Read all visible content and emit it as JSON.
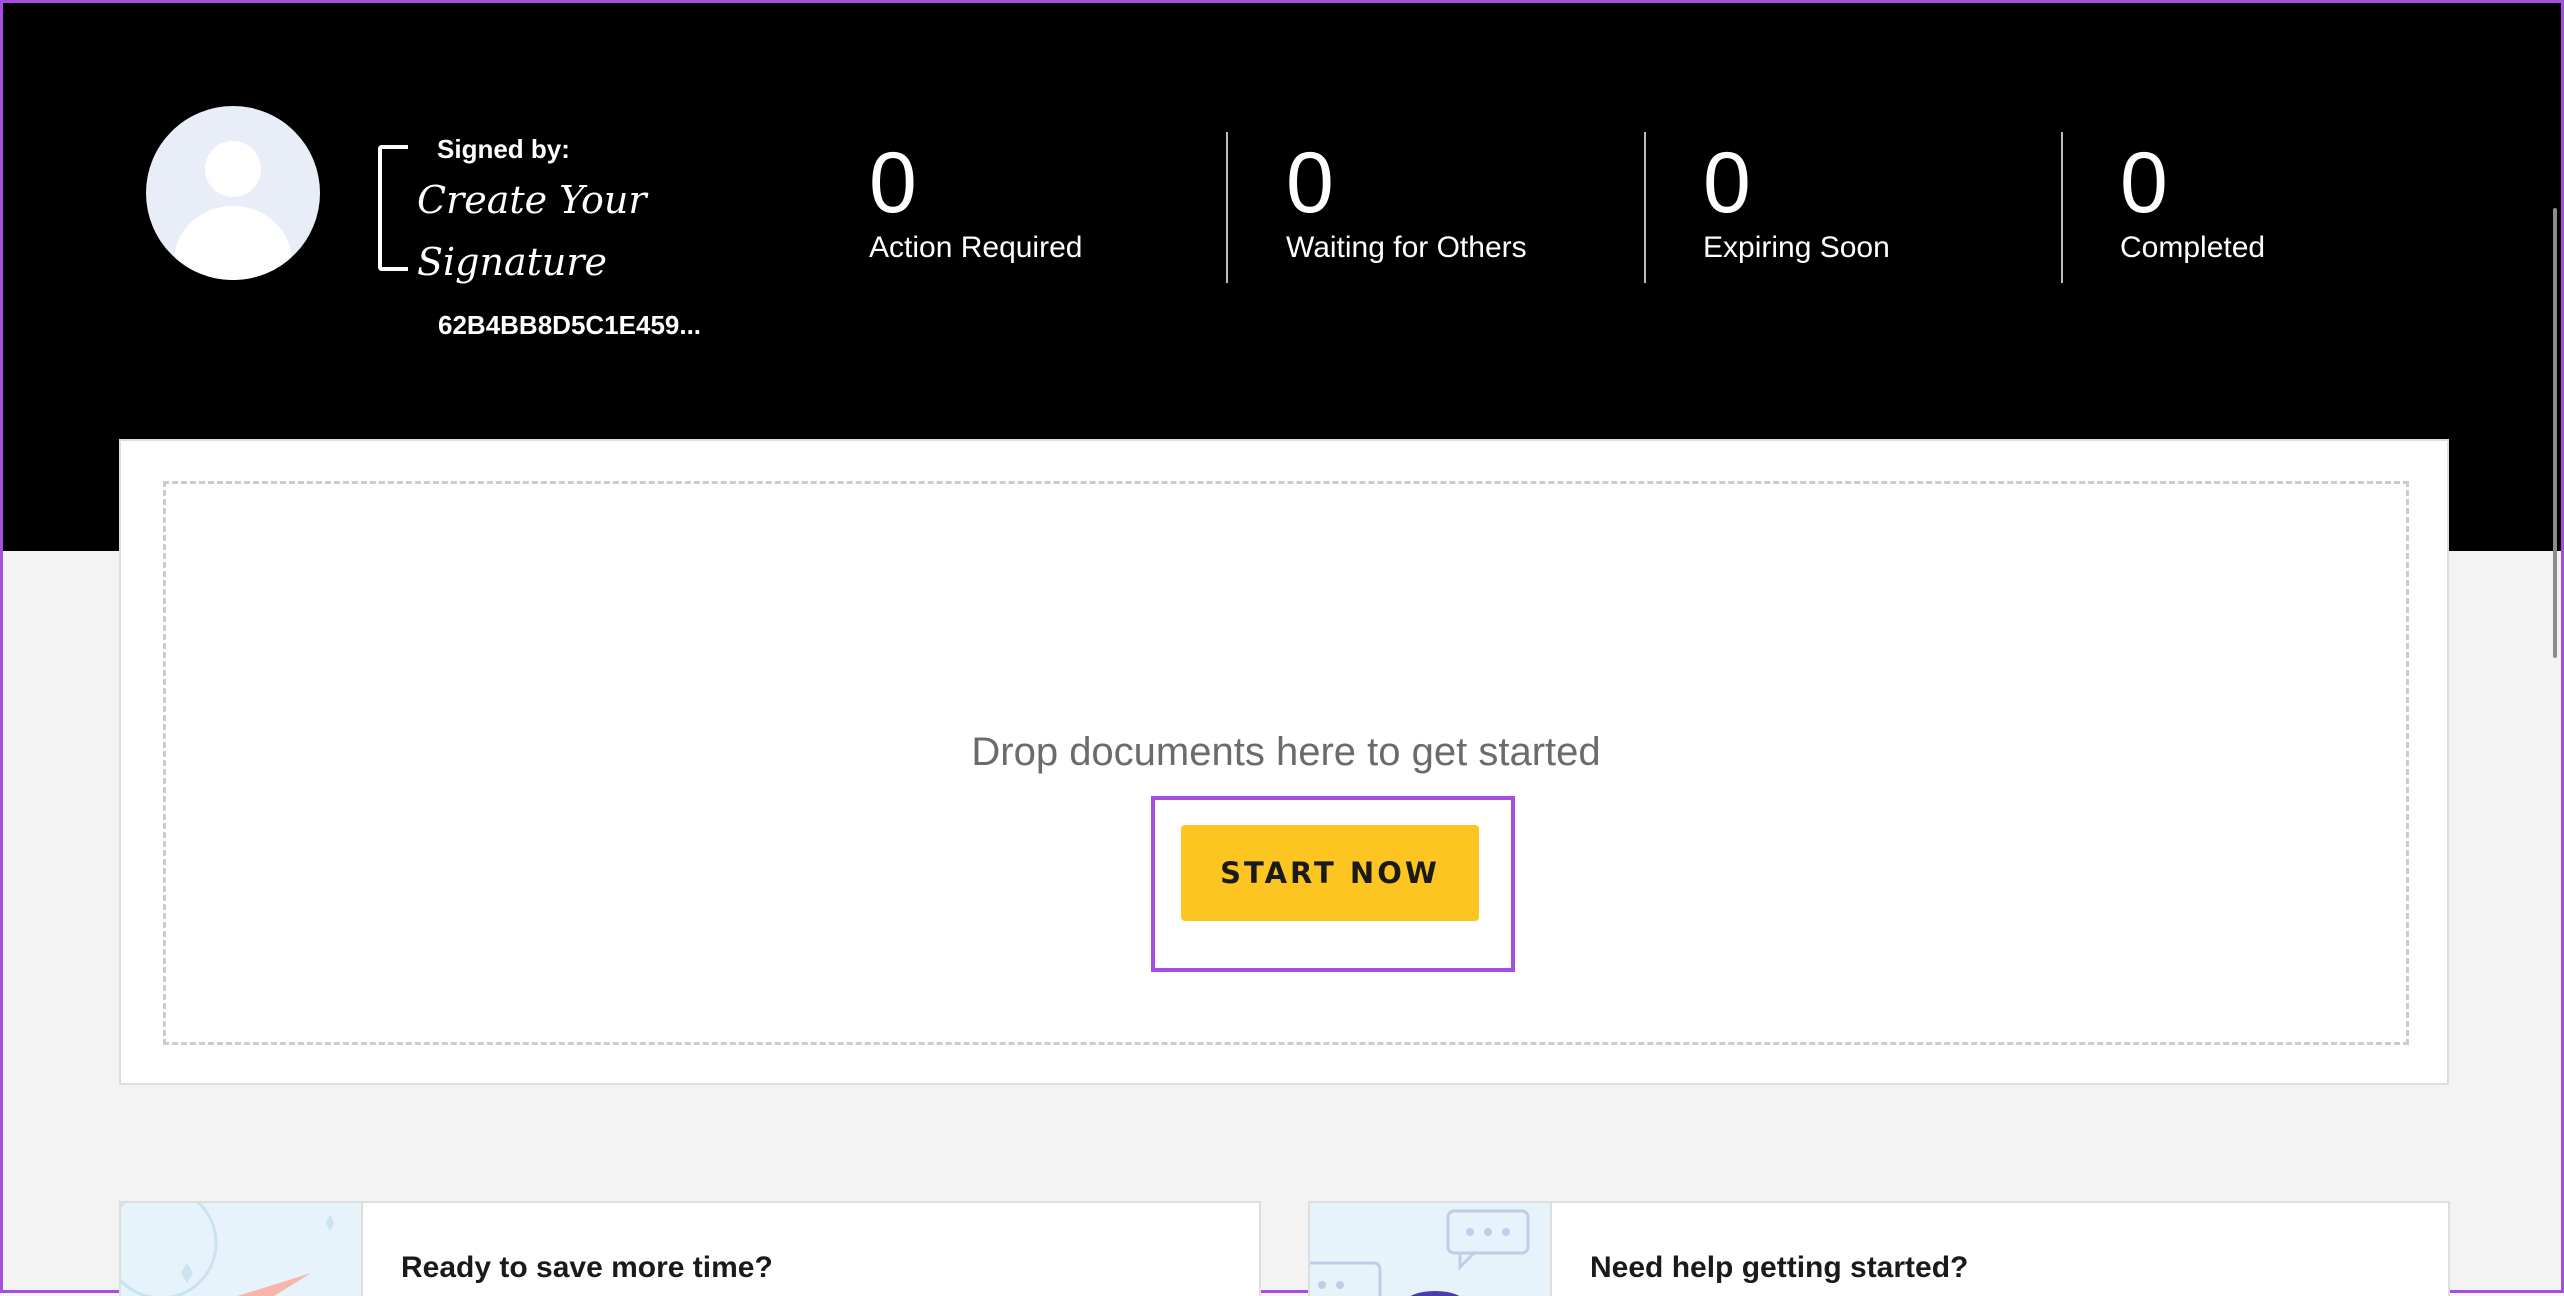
{
  "header": {
    "signed_by_label": "Signed by:",
    "signature_text": "Create Your Signature",
    "signer_id": "62B4BB8D5C1E459..."
  },
  "stats": [
    {
      "value": "0",
      "label": "Action Required"
    },
    {
      "value": "0",
      "label": "Waiting for Others"
    },
    {
      "value": "0",
      "label": "Expiring Soon"
    },
    {
      "value": "0",
      "label": "Completed"
    }
  ],
  "dropzone": {
    "text": "Drop documents here to get started",
    "button_label": "START NOW"
  },
  "promos": [
    {
      "title": "Ready to save more time?"
    },
    {
      "title": "Need help getting started?"
    }
  ],
  "colors": {
    "accent": "#fcc521",
    "highlight": "#a64ee0",
    "header_bg": "#000000"
  }
}
